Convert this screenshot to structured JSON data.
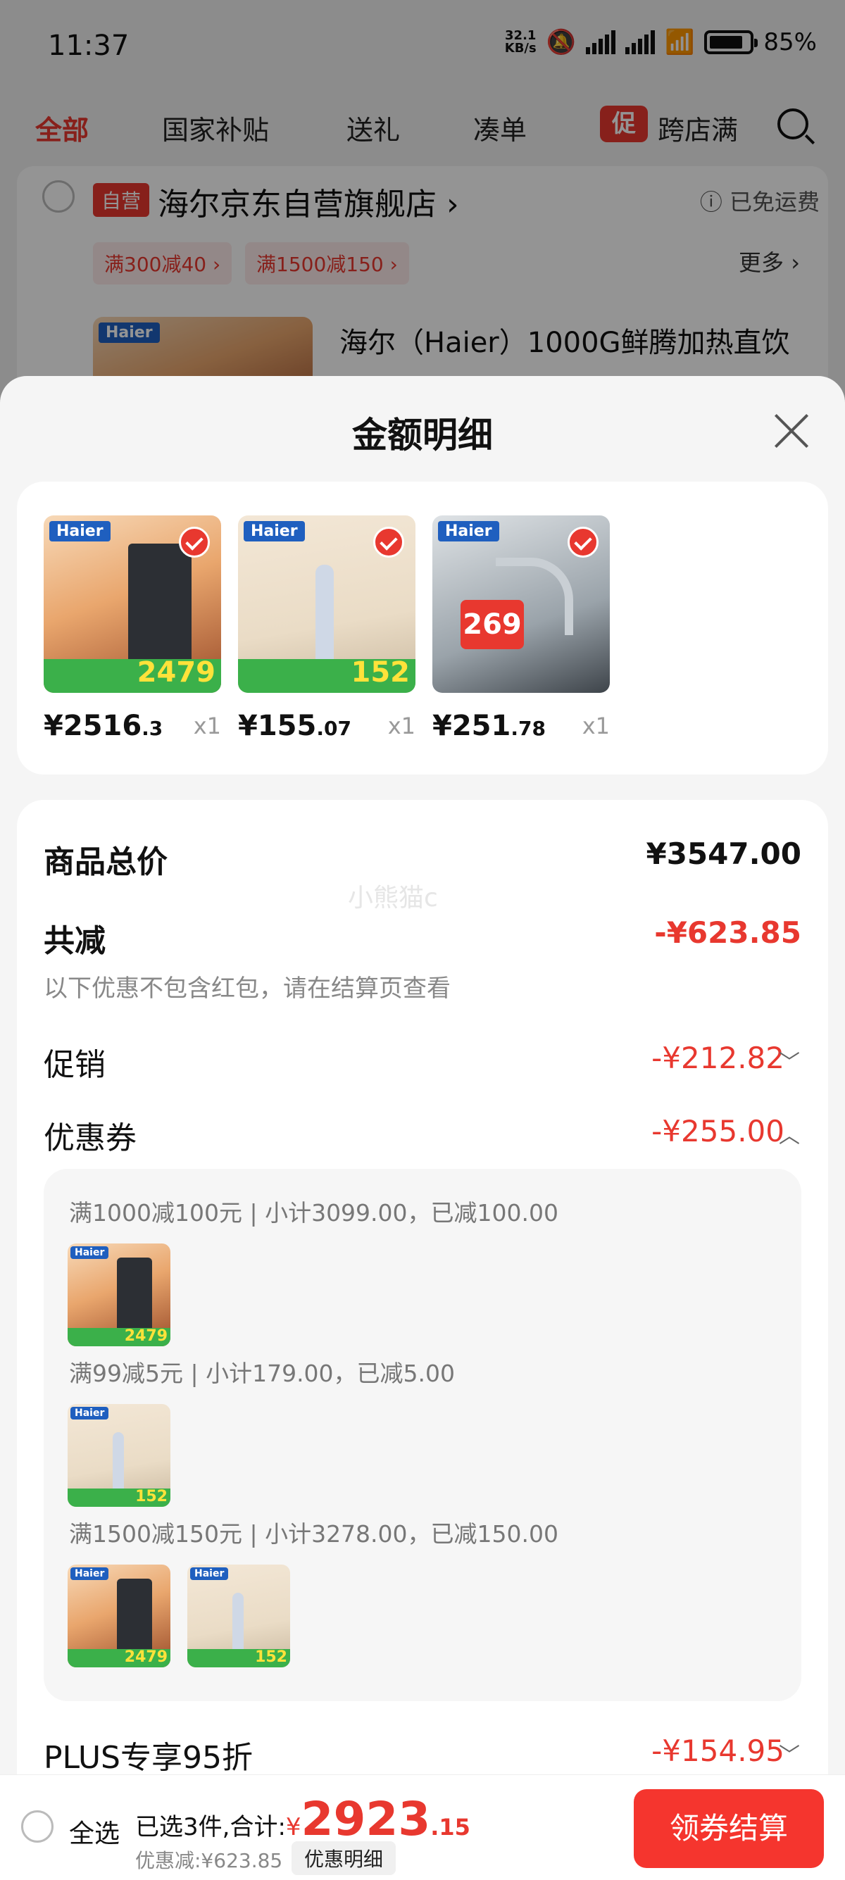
{
  "status": {
    "time": "11:37",
    "speed_value": "32.1",
    "speed_unit": "KB/s",
    "battery": "85%"
  },
  "tabs": [
    {
      "label": "全部"
    },
    {
      "label": "国家补贴"
    },
    {
      "label": "送礼"
    },
    {
      "label": "凑单"
    },
    {
      "label": "跨店满"
    }
  ],
  "promo_tag": "促",
  "shop": {
    "self_tag": "自营",
    "name": "海尔京东自营旗舰店 ›",
    "shipping": "ⓘ 已免运费",
    "coupons": [
      "满300减40 ›",
      "满1500减150 ›"
    ],
    "more": "更多 ›",
    "product_title": "海尔（Haier）1000G鲜腾加热直饮"
  },
  "sheet": {
    "title": "金额明细",
    "products": [
      {
        "brand": "Haier",
        "badge_price": "2479",
        "price_int": "¥2516",
        "price_dec": ".3",
        "qty": "x1"
      },
      {
        "brand": "Haier",
        "badge_price": "152",
        "price_int": "¥155",
        "price_dec": ".07",
        "qty": "x1"
      },
      {
        "brand": "Haier",
        "badge_price": "269",
        "price_int": "¥251",
        "price_dec": ".78",
        "qty": "x1"
      }
    ],
    "total_label": "商品总价",
    "total_value": "¥3547.00",
    "watermark": "小熊猫c",
    "reduce_label": "共减",
    "reduce_value": "-¥623.85",
    "reduce_note": "以下优惠不包含红包，请在结算页查看",
    "promo_label": "促销",
    "promo_value": "-¥212.82",
    "coupon_label": "优惠券",
    "coupon_value": "-¥255.00",
    "coupon_groups": [
      {
        "title": "满1000减100元 | 小计3099.00，已减100.00"
      },
      {
        "title": "满99减5元 | 小计179.00，已减5.00"
      },
      {
        "title": "满1500减150元 | 小计3278.00，已减150.00"
      }
    ],
    "plus_label": "PLUS专享95折",
    "plus_value": "-¥154.95"
  },
  "bottom": {
    "select_all": "全选",
    "summary_prefix": "已选3件,合计:",
    "currency": "¥",
    "total_int": "2923",
    "total_dec": ".15",
    "discount": "优惠减:¥623.85",
    "detail_chip": "优惠明细",
    "checkout": "领券结算"
  }
}
